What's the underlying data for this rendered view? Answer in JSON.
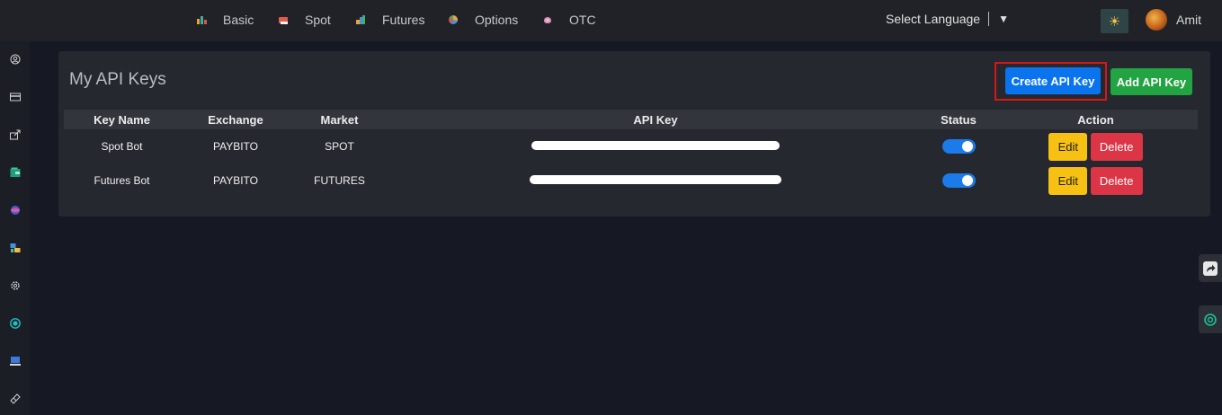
{
  "nav": {
    "items": [
      {
        "label": "Basic",
        "icon": "chart-bars-icon"
      },
      {
        "label": "Spot",
        "icon": "candle-icon"
      },
      {
        "label": "Futures",
        "icon": "trend-icon"
      },
      {
        "label": "Options",
        "icon": "pie-icon"
      },
      {
        "label": "OTC",
        "icon": "flower-icon"
      }
    ],
    "language_label": "Select Language",
    "language_caret": "▼",
    "theme_icon": "☀",
    "username": "Amit"
  },
  "sidebar": {
    "icons": [
      "user-circle-icon",
      "card-icon",
      "share-icon",
      "wallet-icon",
      "globe-icon",
      "exchange-icon",
      "settings-icon",
      "target-icon",
      "monitor-icon",
      "ticket-icon"
    ]
  },
  "panel": {
    "title": "My API Keys",
    "create_button": "Create API Key",
    "add_button": "Add API Key"
  },
  "table": {
    "headers": [
      "Key Name",
      "Exchange",
      "Market",
      "API Key",
      "Status",
      "Action"
    ],
    "rows": [
      {
        "name": "Spot Bot",
        "exchange": "PAYBITO",
        "market": "SPOT",
        "status_on": true
      },
      {
        "name": "Futures Bot",
        "exchange": "PAYBITO",
        "market": "FUTURES",
        "status_on": true
      }
    ],
    "edit_label": "Edit",
    "delete_label": "Delete"
  },
  "colors": {
    "primary": "#0a74ef",
    "success": "#22a443",
    "warning": "#f7c114",
    "danger": "#dc3545",
    "highlight": "#d61717"
  }
}
